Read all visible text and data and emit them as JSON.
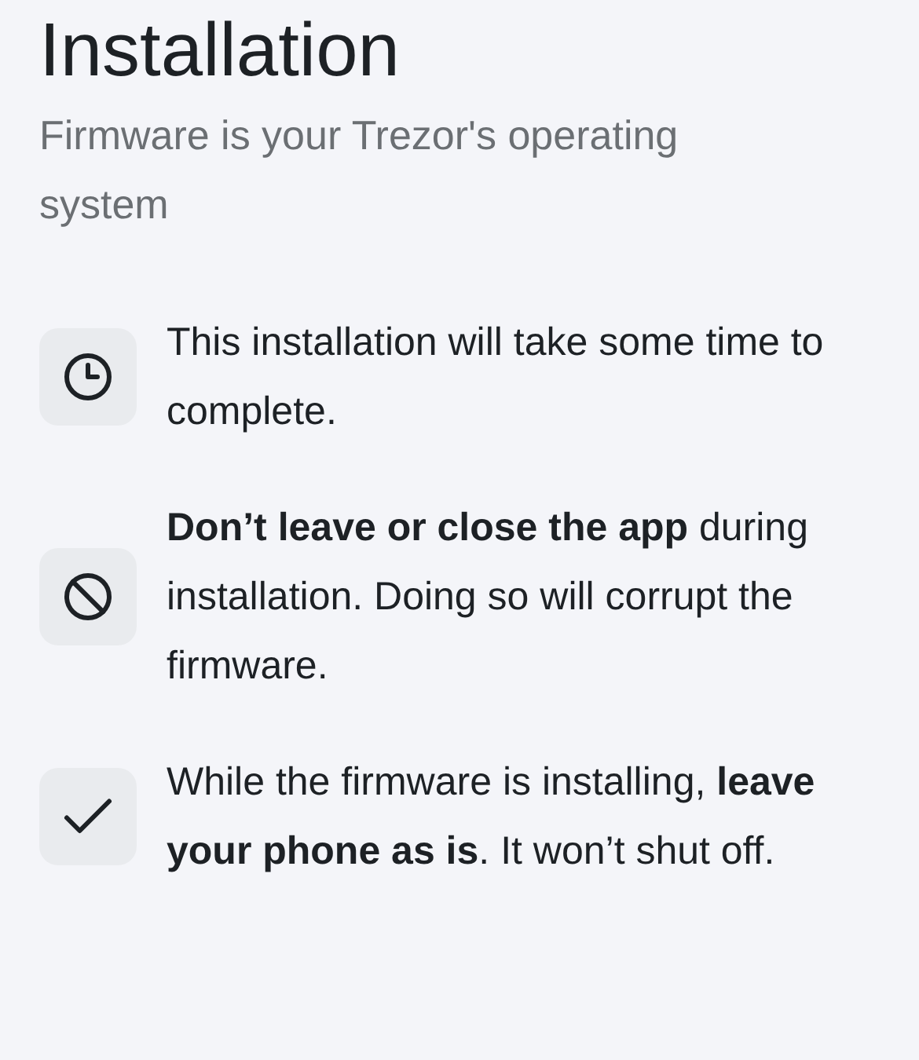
{
  "title": "Installation",
  "subtitle": "Firmware is your Trezor's operating system",
  "notes": [
    {
      "kind": "clock",
      "text": "This installation will take some time to complete."
    },
    {
      "kind": "prohibited",
      "text": "**Don’t leave or close the app** during installation. Doing so will corrupt the firmware."
    },
    {
      "kind": "check",
      "text": "While the firmware is installing, **leave your phone as is**. It won’t shut off."
    }
  ]
}
